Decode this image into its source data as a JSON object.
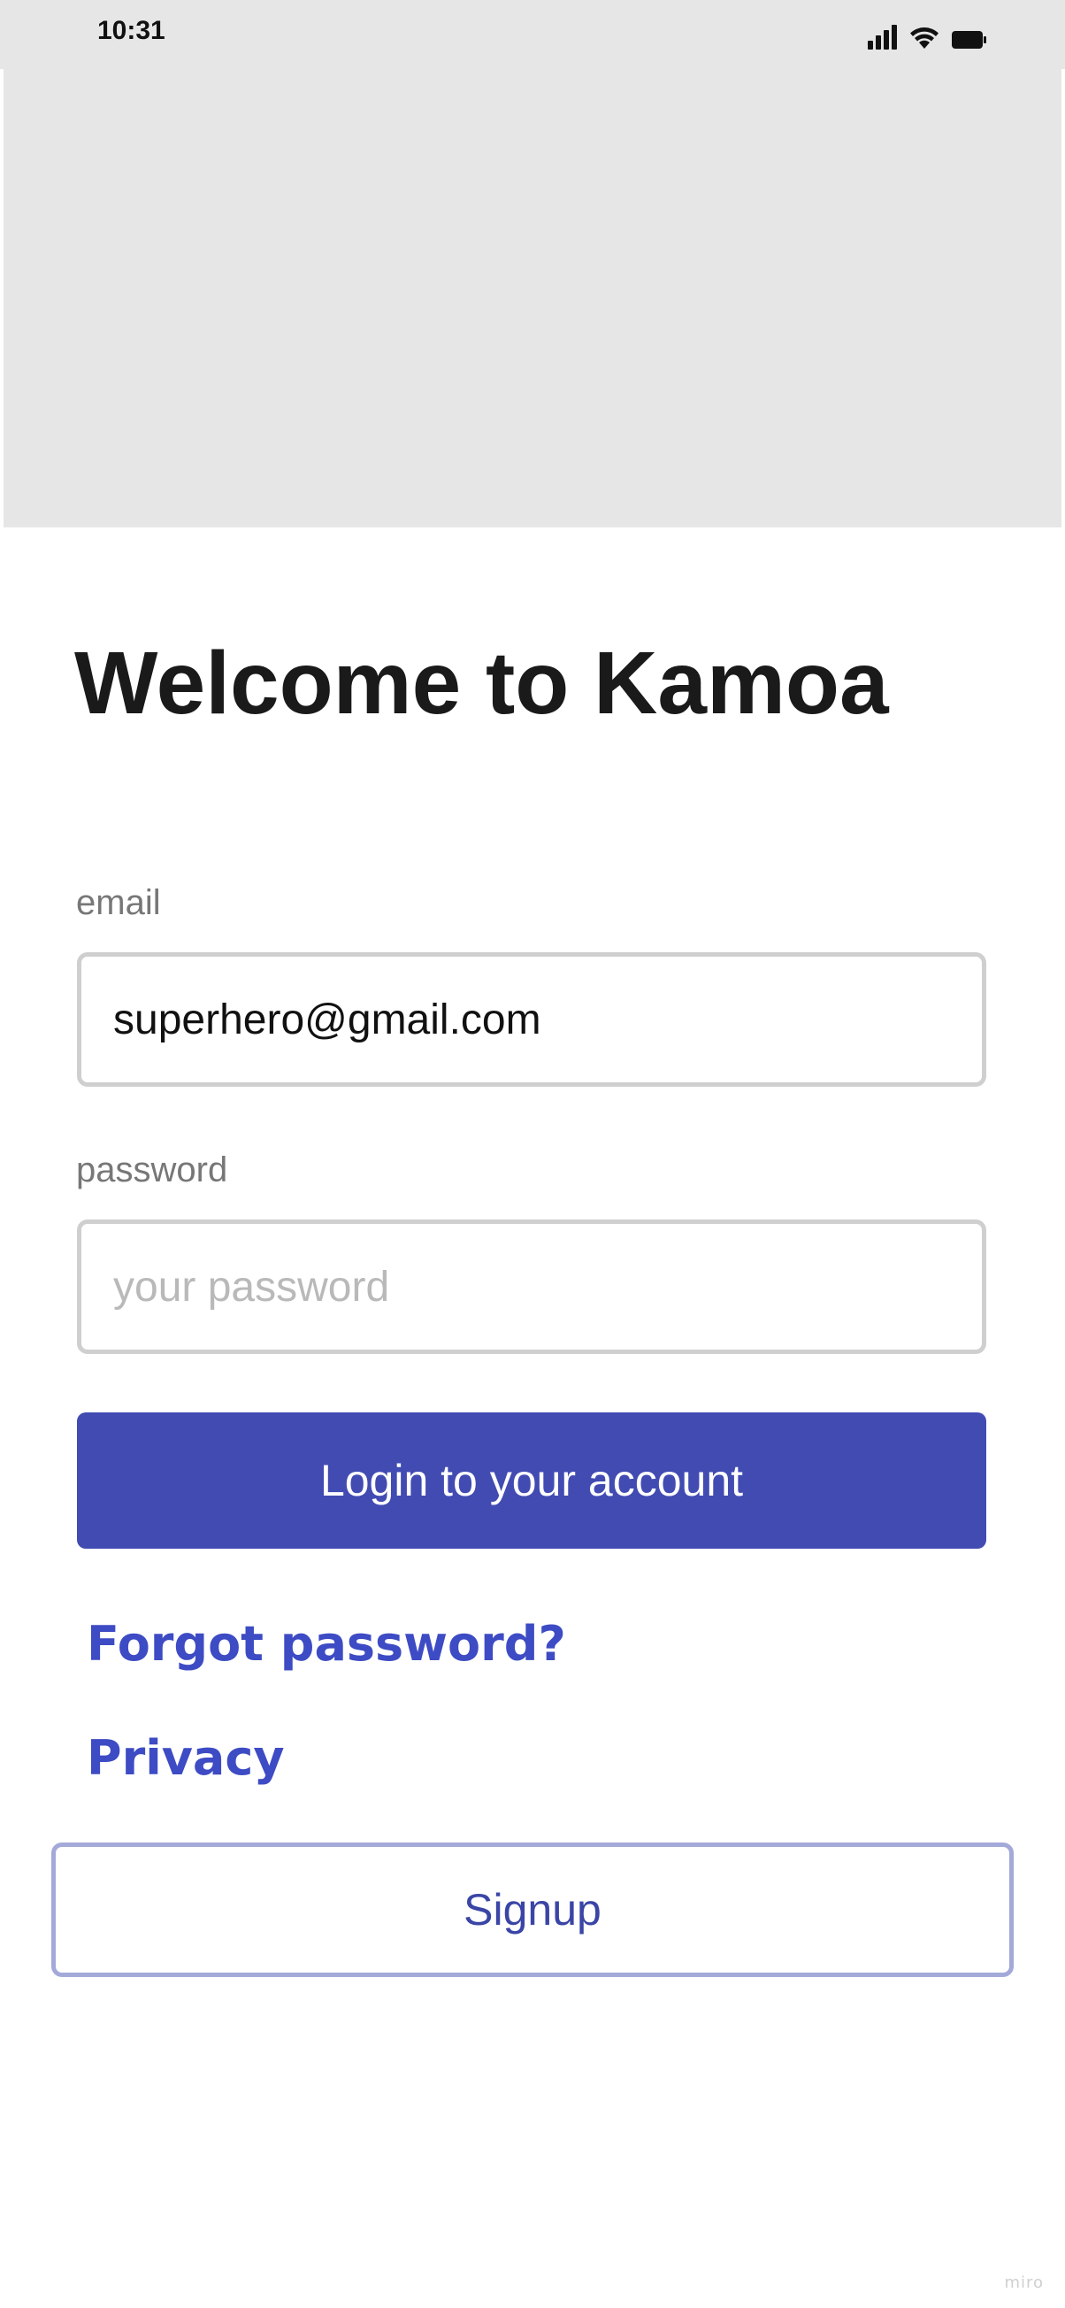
{
  "status_bar": {
    "time": "10:31",
    "icons": [
      "cellular-signal-icon",
      "wifi-icon",
      "battery-icon"
    ]
  },
  "hero": {
    "color": "#e6e6e6"
  },
  "header": {
    "title": "Welcome to Kamoa"
  },
  "form": {
    "email": {
      "label": "email",
      "value": "superhero@gmail.com",
      "placeholder": ""
    },
    "password": {
      "label": "password",
      "value": "",
      "placeholder": "your password"
    },
    "login_label": "Login to your account"
  },
  "links": {
    "forgot_password": "Forgot password?",
    "privacy": "Privacy"
  },
  "signup": {
    "label": "Signup"
  },
  "watermark": "miro",
  "colors": {
    "primary": "#414bb2",
    "link": "#3d4bc4",
    "signup_border": "#a3a9d8",
    "input_border": "#cfcfcf",
    "label": "#777777"
  }
}
